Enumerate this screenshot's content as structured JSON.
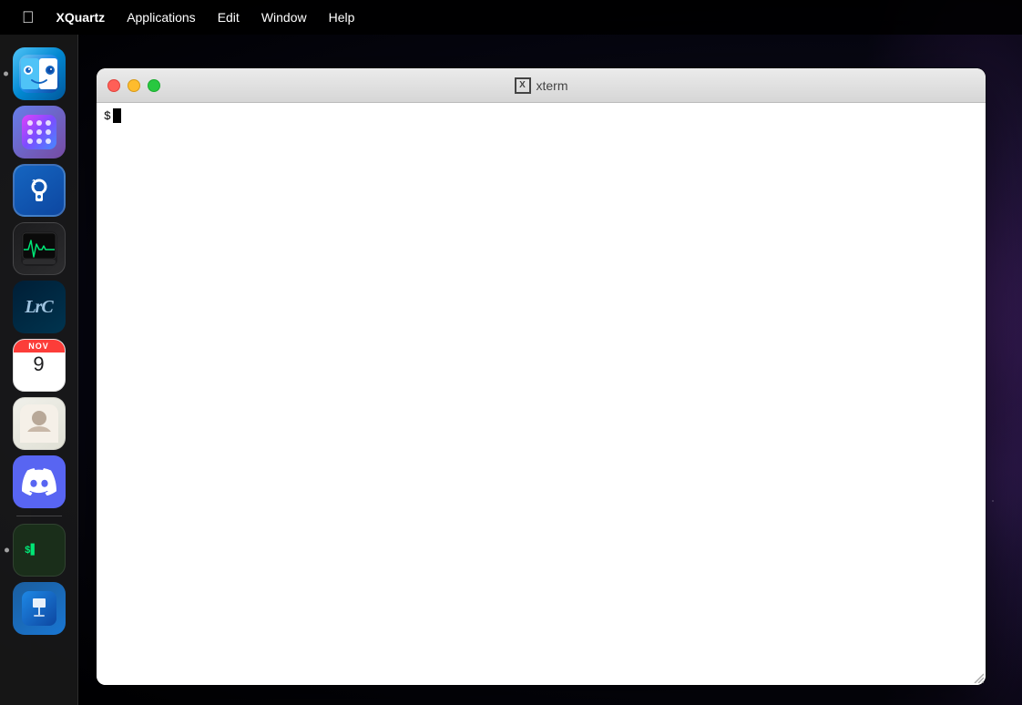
{
  "menubar": {
    "apple_label": "",
    "app_name": "XQuartz",
    "items": [
      "Applications",
      "Edit",
      "Window",
      "Help"
    ]
  },
  "dock": {
    "apps": [
      {
        "name": "finder",
        "label": "Finder",
        "has_dot": true
      },
      {
        "name": "launchpad",
        "label": "Launchpad",
        "has_dot": false
      },
      {
        "name": "onepassword",
        "label": "1Password",
        "has_dot": false
      },
      {
        "name": "activity-monitor",
        "label": "Activity Monitor",
        "has_dot": false
      },
      {
        "name": "lightroom",
        "label": "Adobe Lightroom Classic",
        "has_dot": false
      },
      {
        "name": "calendar",
        "label": "Calendar",
        "has_dot": false,
        "month": "NOV",
        "day": "9"
      },
      {
        "name": "contacts",
        "label": "Contacts",
        "has_dot": false
      },
      {
        "name": "discord",
        "label": "Discord",
        "has_dot": false
      },
      {
        "name": "terminal",
        "label": "Terminal",
        "has_dot": true
      },
      {
        "name": "keynote",
        "label": "Keynote",
        "has_dot": false
      }
    ]
  },
  "xterm_window": {
    "title": "xterm",
    "icon_label": "X",
    "buttons": {
      "close": "close",
      "minimize": "minimize",
      "maximize": "maximize"
    },
    "prompt_char": "$",
    "content": ""
  }
}
